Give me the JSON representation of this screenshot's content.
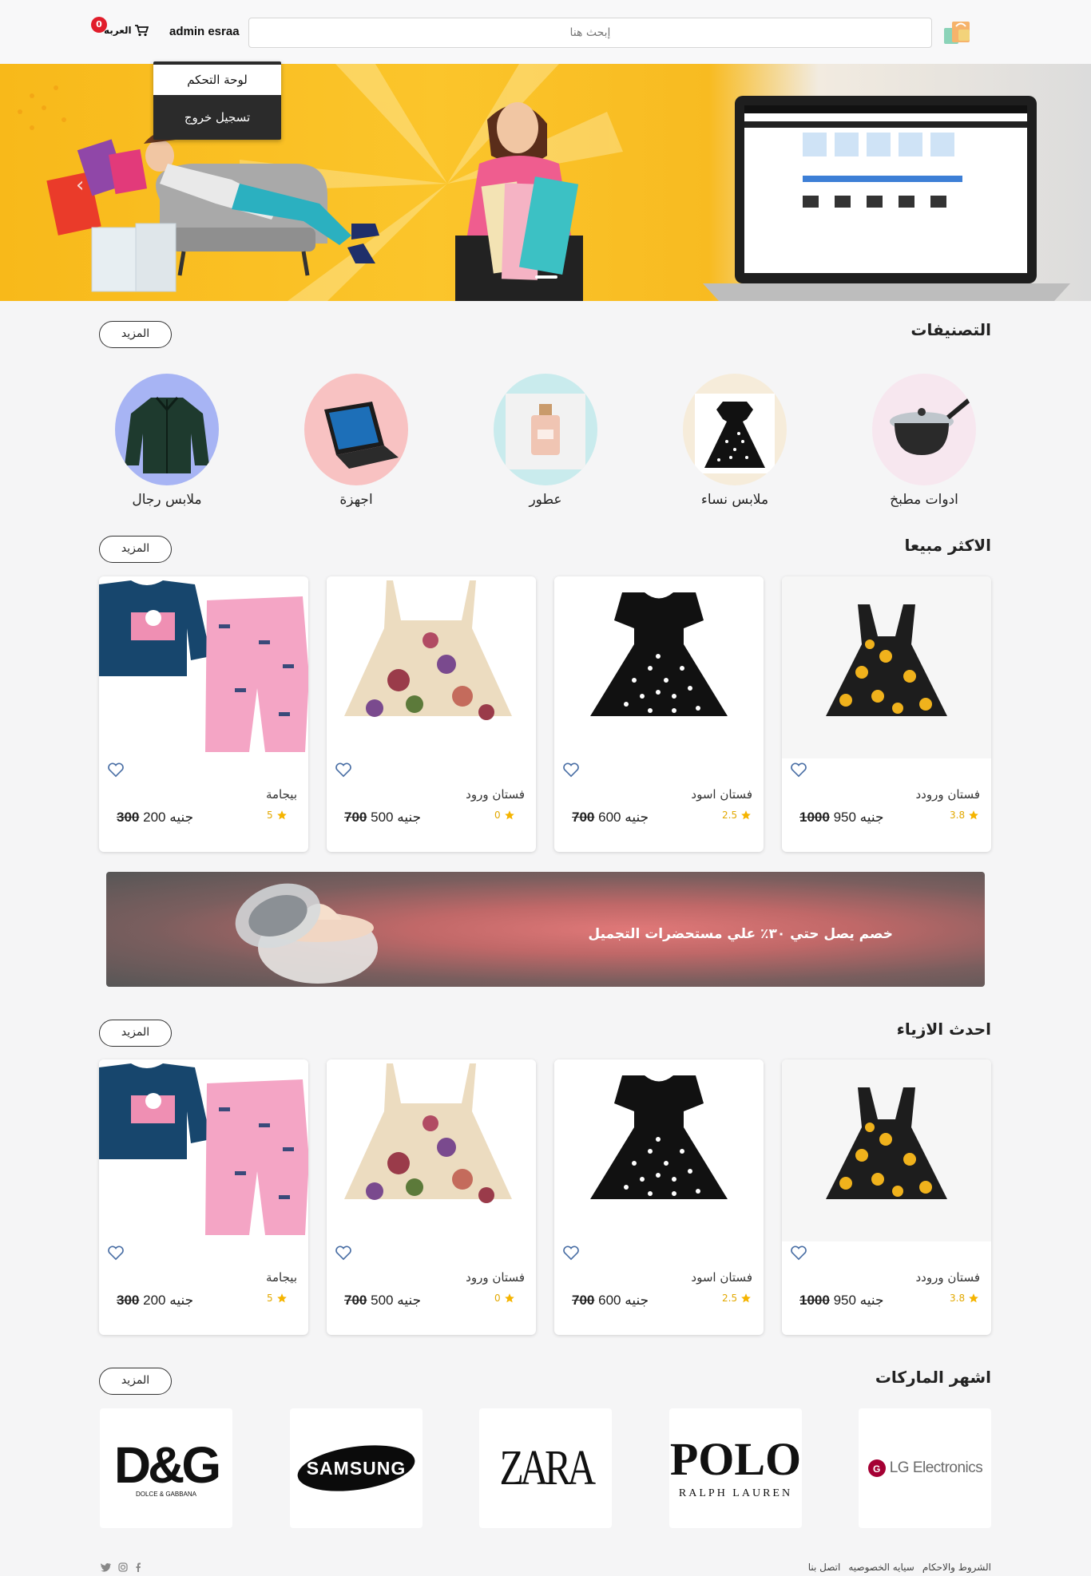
{
  "header": {
    "search_placeholder": "إبحث هنا",
    "user_name": "admin esraa",
    "cart_label": "العربه",
    "cart_count": "0"
  },
  "user_menu": {
    "dashboard": "لوحة التحكم",
    "logout": "تسجيل خروج"
  },
  "categories_section": {
    "title": "التصنيفات",
    "more": "المزيد",
    "items": [
      {
        "label": "ادوات مطبخ",
        "icon": "pot-icon",
        "bg": "#f7e7ef"
      },
      {
        "label": "ملابس نساء",
        "icon": "women-dress-icon",
        "bg": "#f6ecda"
      },
      {
        "label": "عطور",
        "icon": "perfume-icon",
        "bg": "#c9ebed"
      },
      {
        "label": "اجهزة",
        "icon": "laptop-icon",
        "bg": "#f8c2c2"
      },
      {
        "label": "ملابس رجال",
        "icon": "jacket-icon",
        "bg": "#a7b4f4"
      }
    ]
  },
  "best_sellers": {
    "title": "الاكثر مبيعا",
    "more": "المزيد",
    "products": [
      {
        "name": "فستان ورودد",
        "rating": "3.8",
        "old_price": "1000",
        "new_price": "950",
        "currency": "جنيه"
      },
      {
        "name": "فستان اسود",
        "rating": "2.5",
        "old_price": "700",
        "new_price": "600",
        "currency": "جنيه"
      },
      {
        "name": "فستان ورود",
        "rating": "0",
        "old_price": "700",
        "new_price": "500",
        "currency": "جنيه"
      },
      {
        "name": "بيجامة",
        "rating": "5",
        "old_price": "300",
        "new_price": "200",
        "currency": "جنيه"
      }
    ]
  },
  "promo": {
    "text": "خصم يصل حتي ٣٠٪ علي مستحضرات التجميل"
  },
  "latest_fashion": {
    "title": "احدث الازياء",
    "more": "المزيد",
    "products": [
      {
        "name": "فستان ورودد",
        "rating": "3.8",
        "old_price": "1000",
        "new_price": "950",
        "currency": "جنيه"
      },
      {
        "name": "فستان اسود",
        "rating": "2.5",
        "old_price": "700",
        "new_price": "600",
        "currency": "جنيه"
      },
      {
        "name": "فستان ورود",
        "rating": "0",
        "old_price": "700",
        "new_price": "500",
        "currency": "جنيه"
      },
      {
        "name": "بيجامة",
        "rating": "5",
        "old_price": "300",
        "new_price": "200",
        "currency": "جنيه"
      }
    ]
  },
  "brands_section": {
    "title": "اشهر الماركات",
    "more": "المزيد",
    "brands": [
      {
        "name": "LG Electronics"
      },
      {
        "name": "POLO",
        "sub": "RALPH LAUREN"
      },
      {
        "name": "ZARA"
      },
      {
        "name": "SAMSUNG"
      },
      {
        "name": "D&G",
        "sub": "DOLCE & GABBANA"
      }
    ]
  },
  "footer": {
    "links": [
      "الشروط والاحكام",
      "سيايه الخصوصيه",
      "اتصل بنا"
    ]
  },
  "colors": {
    "star": "#f5b400",
    "badge": "#e11d2b",
    "hero_yellow": "#fbc52b"
  }
}
